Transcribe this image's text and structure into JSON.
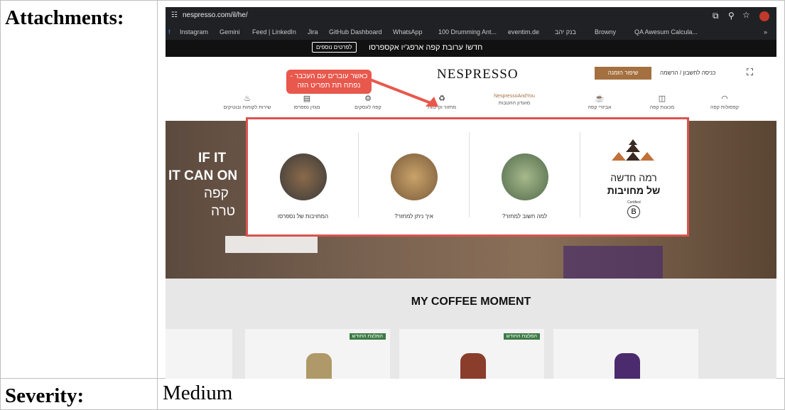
{
  "labels": {
    "attachments": "Attachments:",
    "severity": "Severity:"
  },
  "severity_value": "Medium",
  "browser": {
    "url": "nespresso.com/il/he/",
    "bookmarks": [
      "Instagram",
      "Gemini",
      "Feed | LinkedIn",
      "Jira",
      "GitHub Dashboard",
      "WhatsApp",
      "100 Drumming Ant...",
      "eventim.de",
      "בנק יהב",
      "Browny",
      "QA Awesum Calcula..."
    ]
  },
  "site": {
    "promo_text": "חדש! ערובת קפה ארפג'יו אקספרסו",
    "promo_button": "לפרטים נוספים",
    "logo": "NESPRESSO",
    "order_button": "שיפור הזמנה",
    "login": "כניסה לחשבון / הרשמה",
    "nav": [
      "קפסולות קפה",
      "מכונות קפה",
      "אביזרי קפה",
      "מועדון ההטבות",
      "מחזור וקיימות",
      "קפה לעסקים",
      "מגזין נספרסו",
      "שירות לקוחות ובוטיקים"
    ],
    "nav_highlight": "NespressoAndYou",
    "callout": "כאשר עוברים עם העכבר - נפתח תת תפריט הזה",
    "hero_text": [
      "IF IT",
      "IT CAN ON",
      "קפה",
      "טרה"
    ],
    "mega_title_1": "רמה חדשה",
    "mega_title_2": "של מחויבות",
    "mega_captions": [
      "המחויבות של נספרסו",
      "איך ניתן למחזר?",
      "למה חשוב למחזר?"
    ],
    "bcorp": "Certified",
    "section_title": "MY COFFEE MOMENT",
    "card_badge": "המלצת החודש"
  }
}
